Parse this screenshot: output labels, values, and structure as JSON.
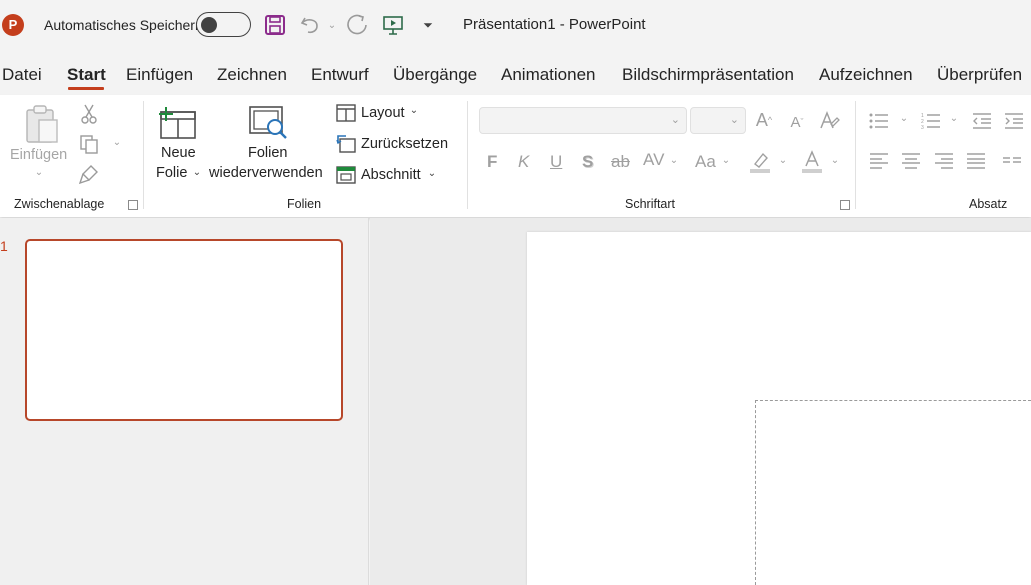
{
  "titlebar": {
    "app_logo": "P",
    "autosave_label": "Automatisches Speichern",
    "autosave_on": false,
    "document_title": "Präsentation1  -  PowerPoint",
    "icons": [
      "powerpoint-logo-icon",
      "save-icon",
      "undo-icon",
      "redo-icon",
      "start-slideshow-icon",
      "customize-toolbar-icon"
    ]
  },
  "tabs": [
    {
      "label": "Datei"
    },
    {
      "label": "Start",
      "active": true
    },
    {
      "label": "Einfügen"
    },
    {
      "label": "Zeichnen"
    },
    {
      "label": "Entwurf"
    },
    {
      "label": "Übergänge"
    },
    {
      "label": "Animationen"
    },
    {
      "label": "Bildschirmpräsentation"
    },
    {
      "label": "Aufzeichnen"
    },
    {
      "label": "Überprüfen"
    }
  ],
  "ribbon": {
    "clipboard": {
      "label": "Zwischenablage",
      "paste": "Einfügen"
    },
    "slides": {
      "label": "Folien",
      "new_slide_line1": "Neue",
      "new_slide_line2": "Folie",
      "reuse_line1": "Folien",
      "reuse_line2": "wiederverwenden",
      "layout": "Layout",
      "reset": "Zurücksetzen",
      "section": "Abschnitt"
    },
    "font": {
      "label": "Schriftart",
      "font_name": "",
      "font_size": "",
      "bold": "F",
      "italic": "K",
      "underline": "U",
      "shadow": "S",
      "strikethrough": "ab",
      "spacing": "AV",
      "change_case": "Aa"
    },
    "paragraph": {
      "label": "Absatz"
    }
  },
  "thumbnails": {
    "slide_number": "1"
  },
  "colors": {
    "accent": "#c43e1c",
    "thumbnail_border": "#b7472a",
    "ribbon_bg": "#ffffff",
    "app_bg": "#f3f3f3"
  }
}
